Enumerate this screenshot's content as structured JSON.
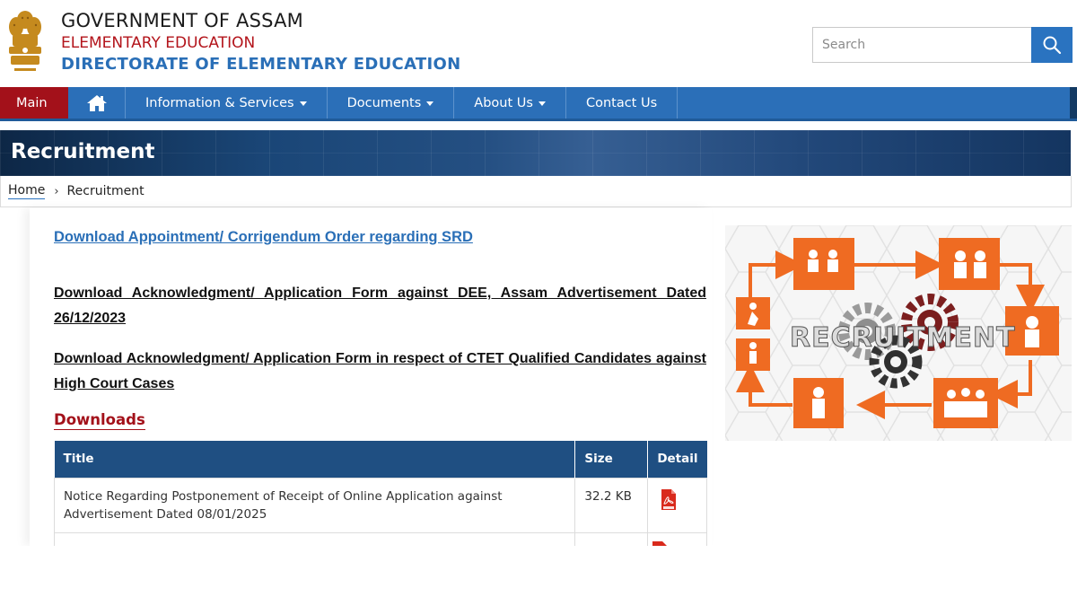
{
  "header": {
    "line1": "GOVERNMENT OF ASSAM",
    "line2": "ELEMENTARY EDUCATION",
    "line3": "DIRECTORATE OF ELEMENTARY EDUCATION",
    "search_placeholder": "Search"
  },
  "nav": {
    "main": "Main",
    "items": [
      "Information & Services",
      "Documents",
      "About Us",
      "Contact Us"
    ]
  },
  "banner": {
    "title": "Recruitment"
  },
  "breadcrumb": {
    "home": "Home",
    "current": "Recruitment"
  },
  "content": {
    "link_srd": "Download Appointment/ Corrigendum Order regarding SRD",
    "link_ack_dee": "Download Acknowledgment/ Application Form against DEE, Assam Advertisement Dated 26/12/2023",
    "link_ack_ctet": "Download Acknowledgment/ Application Form in respect of CTET Qualified Candidates against High Court Cases",
    "downloads_heading": "Downloads"
  },
  "table": {
    "headers": [
      "Title",
      "Size",
      "Detail"
    ],
    "rows": [
      {
        "title": "Notice Regarding Postponement of Receipt of Online Application against Advertisement Dated 08/01/2025",
        "size": "32.2 KB"
      }
    ]
  },
  "image": {
    "overlay_text": "RECRUITMENT"
  },
  "colors": {
    "nav_blue": "#2b6fb8",
    "accent_red": "#a3111a",
    "table_header": "#1f4f82",
    "icon_orange": "#ef6b22"
  }
}
